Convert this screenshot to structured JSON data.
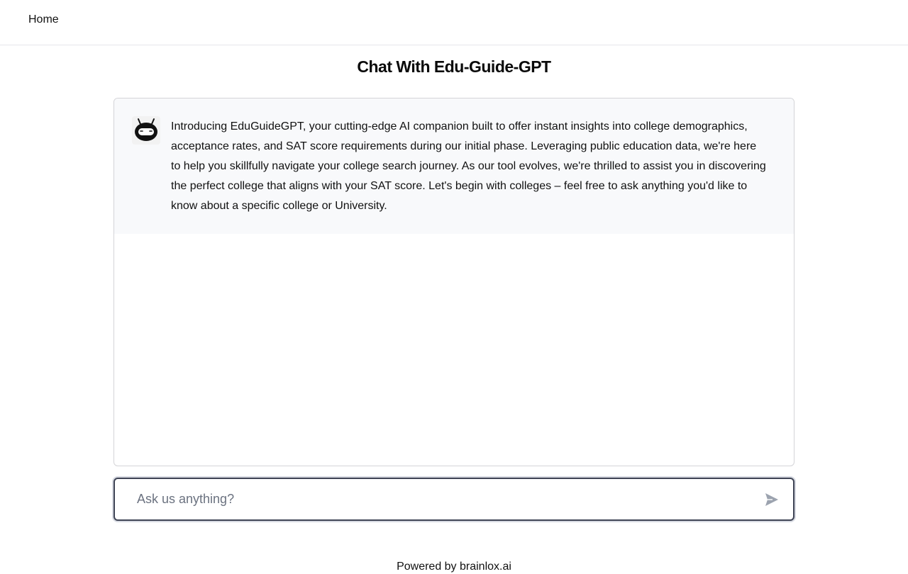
{
  "nav": {
    "home_label": "Home"
  },
  "page": {
    "title": "Chat With Edu-Guide-GPT"
  },
  "chat": {
    "messages": [
      {
        "sender_icon": "robot-icon",
        "text": "Introducing EduGuideGPT, your cutting-edge AI companion built to offer instant insights into college demographics, acceptance rates, and SAT score requirements during our initial phase. Leveraging public education data, we're here to help you skillfully navigate your college search journey. As our tool evolves, we're thrilled to assist you in discovering the perfect college that aligns with your SAT score. Let's begin with colleges – feel free to ask anything you'd like to know about a specific college or University."
      }
    ]
  },
  "composer": {
    "placeholder": "Ask us anything?",
    "value": "",
    "send_icon": "send-icon"
  },
  "footer": {
    "text": "Powered by brainlox.ai"
  },
  "colors": {
    "message_background": "#f8f9fb",
    "border": "#d4d4d8",
    "composer_border": "#3f4455",
    "placeholder": "#6b7280"
  }
}
